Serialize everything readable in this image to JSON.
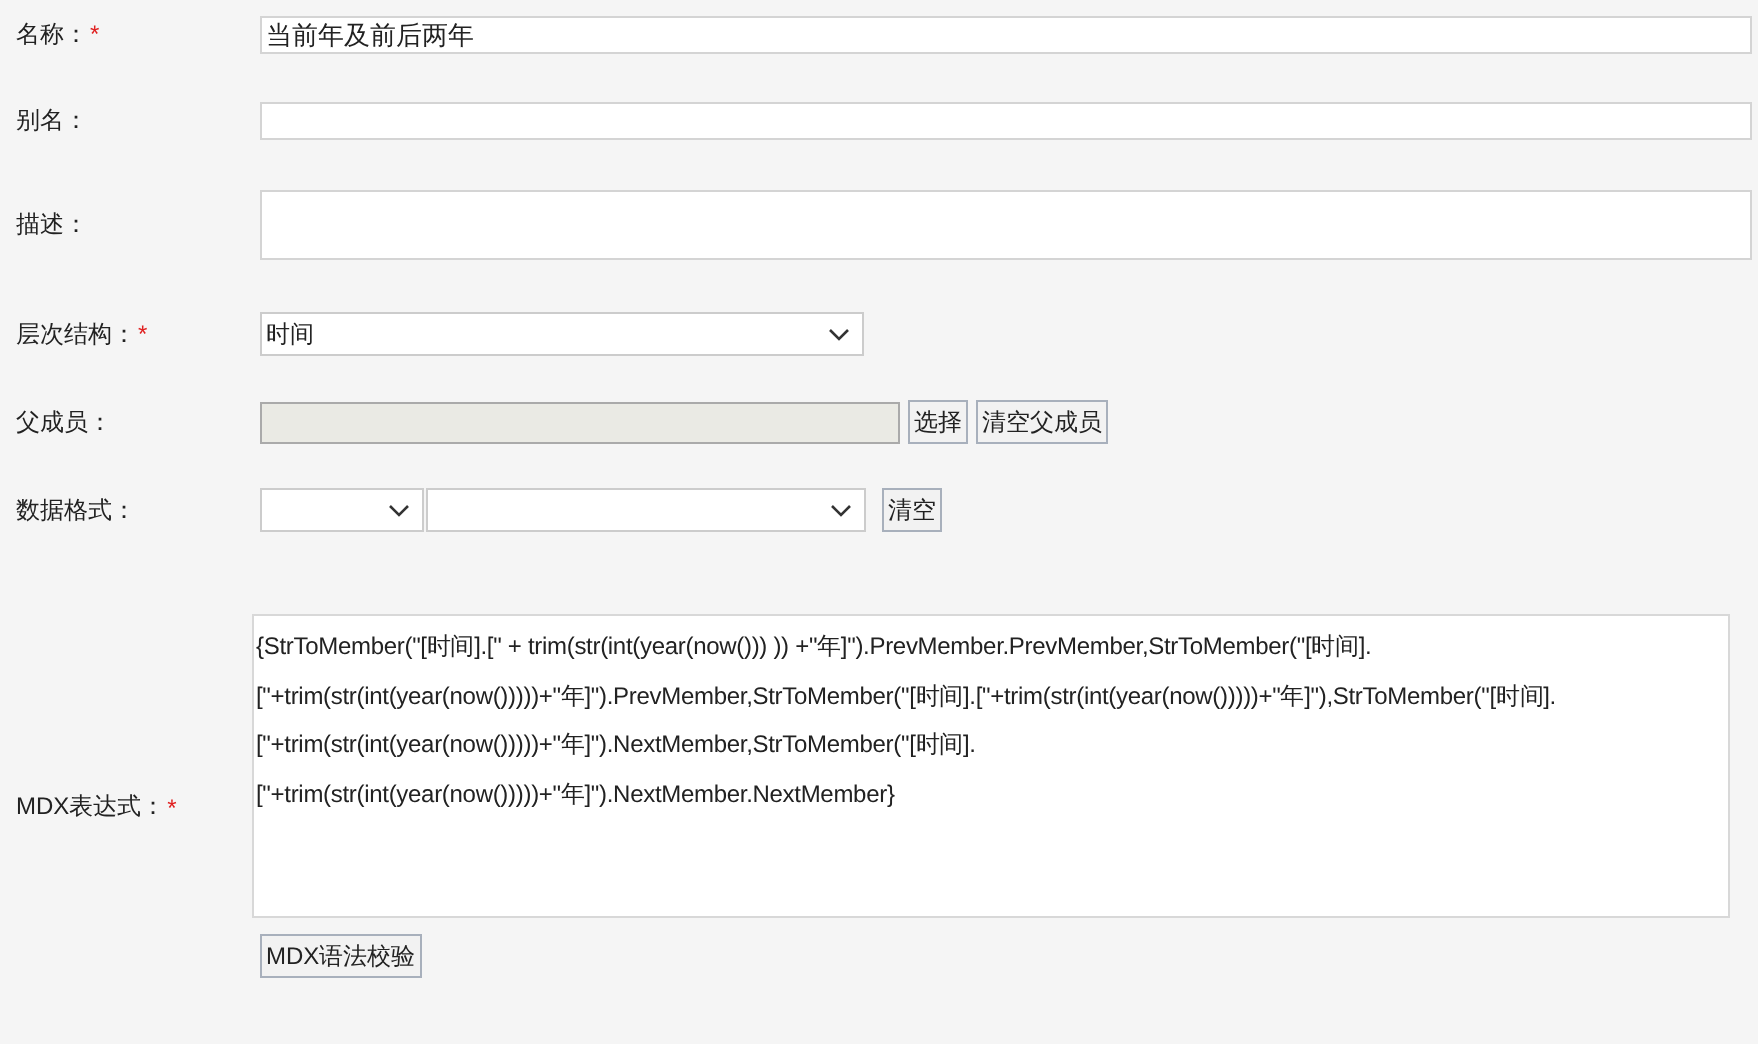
{
  "fields": [
    {
      "kind": "text",
      "label": "名称：",
      "required_mark": "*",
      "value": "当前年及前后两年"
    },
    {
      "kind": "text",
      "label": "别名："
    },
    {
      "kind": "textarea",
      "label": "描述："
    },
    {
      "kind": "select",
      "label": "层次结构：",
      "required_mark": "*",
      "value": "时间"
    },
    {
      "kind": "picker",
      "label": "父成员：",
      "disabled": true,
      "buttons": [
        "选择",
        "清空父成员"
      ]
    },
    {
      "kind": "format",
      "label": "数据格式：",
      "buttons": [
        "清空"
      ]
    },
    {
      "kind": "code",
      "label": "MDX表达式：",
      "required_mark": "*",
      "lines": [
        "{StrToMember(\"[时间].[\" + trim(str(int(year(now())) )) +\"年]\").PrevMember.PrevMember,StrToMember(\"[时间].",
        "[\"+trim(str(int(year(now()))))+\"年]\").PrevMember,StrToMember(\"[时间].[\"+trim(str(int(year(now()))))+\"年]\"),StrToMember(\"[时间].",
        "[\"+trim(str(int(year(now()))))+\"年]\").NextMember,StrToMember(\"[时间].",
        "[\"+trim(str(int(year(now()))))+\"年]\").NextMember.NextMember}"
      ]
    }
  ],
  "validate_button": "MDX语法校验"
}
